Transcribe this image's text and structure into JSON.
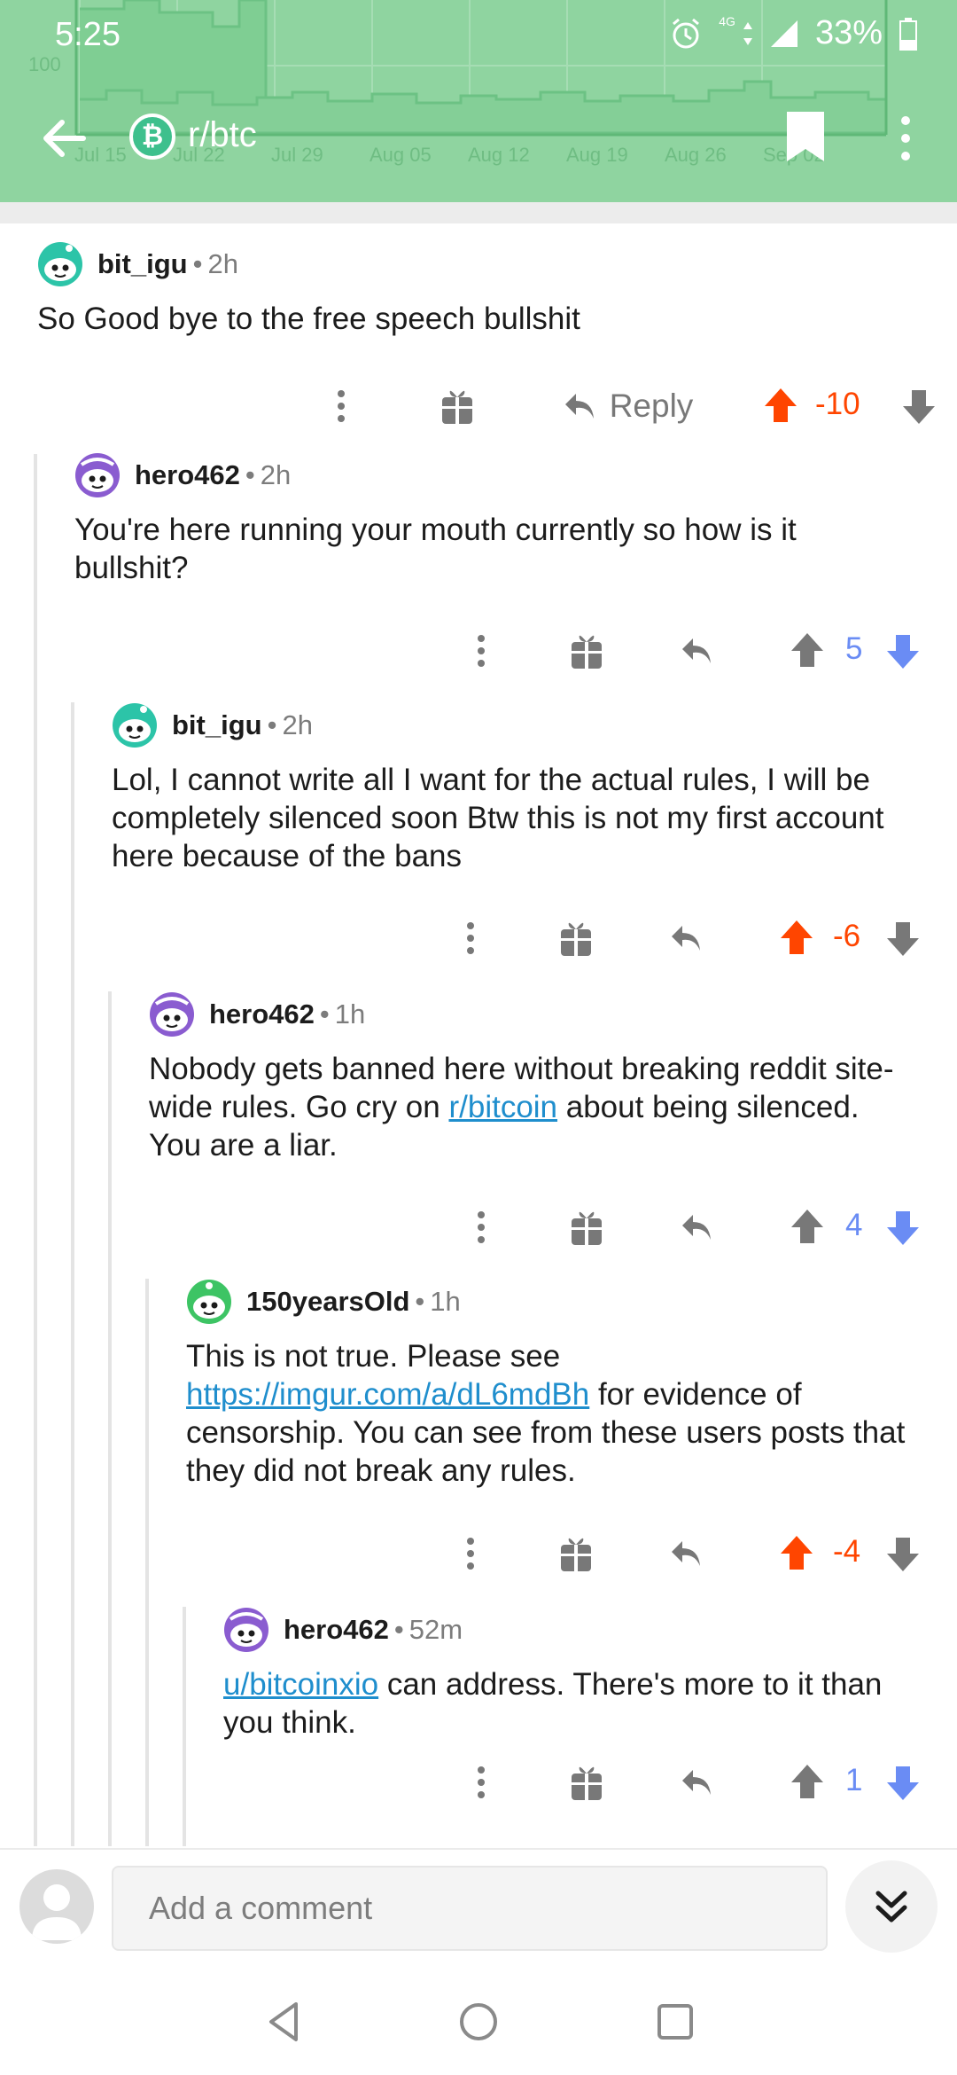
{
  "status_bar": {
    "time": "5:25",
    "network": "4G",
    "battery": "33%"
  },
  "header": {
    "subreddit": "r/btc",
    "chart_bg": {
      "y_tick": "100",
      "x_ticks": [
        "Jul 15",
        "Jul 22",
        "Jul 29",
        "Aug 05",
        "Aug 12",
        "Aug 19",
        "Aug 26",
        "Sep 02"
      ]
    }
  },
  "comments": [
    {
      "username": "bit_igu",
      "time": "2h",
      "avatar_color": "#2cc4a8",
      "body": "So Good bye to the free speech bullshit",
      "score": "-10",
      "vote": "up",
      "reply_label": "Reply"
    },
    {
      "username": "hero462",
      "time": "2h",
      "avatar_color": "#8a5cd0",
      "body": "You're here running your mouth currently so how is it bullshit?",
      "score": "5",
      "vote": "down"
    },
    {
      "username": "bit_igu",
      "time": "2h",
      "avatar_color": "#2cc4a8",
      "body": "Lol, I cannot write all I want for the actual rules,  I will be completely silenced soon Btw this is not my first account here because of the bans",
      "score": "-6",
      "vote": "up"
    },
    {
      "username": "hero462",
      "time": "1h",
      "avatar_color": "#8a5cd0",
      "body_parts": {
        "a": "Nobody gets banned here without breaking reddit site-wide rules.  Go cry on ",
        "link": "r/bitcoin",
        "b": " about being silenced.  You are a liar."
      },
      "score": "4",
      "vote": "down"
    },
    {
      "username": "150yearsOld",
      "time": "1h",
      "avatar_color": "#3dc464",
      "body_parts": {
        "a": "This is not true. Please see ",
        "link": "https://imgur.com/a/dL6mdBh",
        "b": " for evidence of censorship. You can see from these users posts that they did not break any rules."
      },
      "score": "-4",
      "vote": "up"
    },
    {
      "username": "hero462",
      "time": "52m",
      "avatar_color": "#8a5cd0",
      "body_parts": {
        "link": "u/bitcoinxio",
        "b": "  can address.  There's more to it than you think."
      },
      "score": "1",
      "vote": "down"
    }
  ],
  "composer": {
    "placeholder": "Add a comment"
  },
  "colors": {
    "upvote": "#ff4500",
    "downvote": "#6a8cf4",
    "neutral_icon": "#787878",
    "header_green": "#8fd4a0",
    "link": "#1f8ecd"
  }
}
